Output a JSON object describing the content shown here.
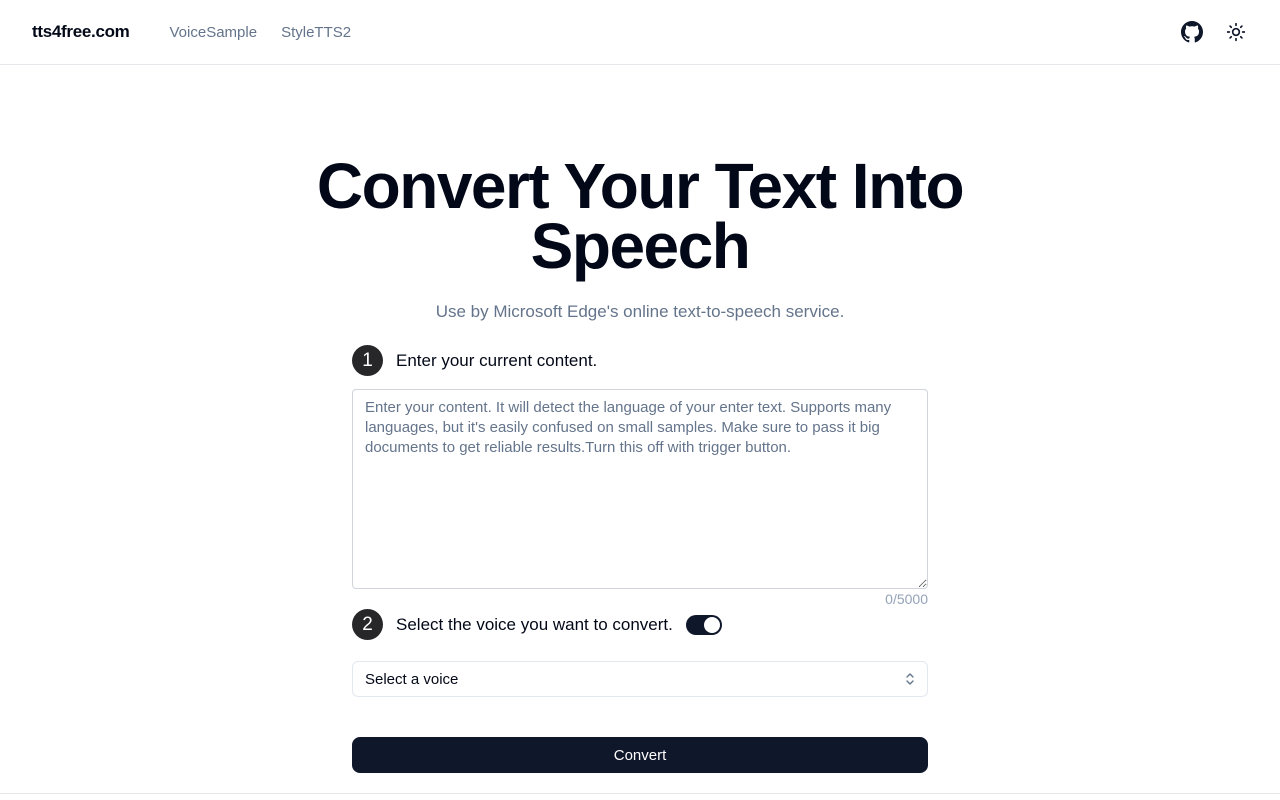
{
  "header": {
    "logo": "tts4free.com",
    "nav": [
      {
        "label": "VoiceSample"
      },
      {
        "label": "StyleTTS2"
      }
    ],
    "icons": [
      "github-icon",
      "sun-icon"
    ]
  },
  "hero": {
    "title": "Convert Your Text Into Speech",
    "subtitle": "Use by Microsoft Edge's online text-to-speech service."
  },
  "step1": {
    "number": "1",
    "label": "Enter your current content.",
    "textarea_value": "",
    "textarea_placeholder": "Enter your content. It will detect the language of your enter text. Supports many languages, but it's easily confused on small samples. Make sure to pass it big documents to get reliable results.Turn this off with trigger button.",
    "counter": "0/5000"
  },
  "step2": {
    "number": "2",
    "label": "Select the voice you want to convert.",
    "toggle_on": true,
    "select_value": "Select a voice"
  },
  "actions": {
    "convert_label": "Convert"
  },
  "colors": {
    "primary": "#0f172a",
    "badge": "#27272a",
    "muted_text": "#64748b",
    "border": "#e5e7eb"
  }
}
